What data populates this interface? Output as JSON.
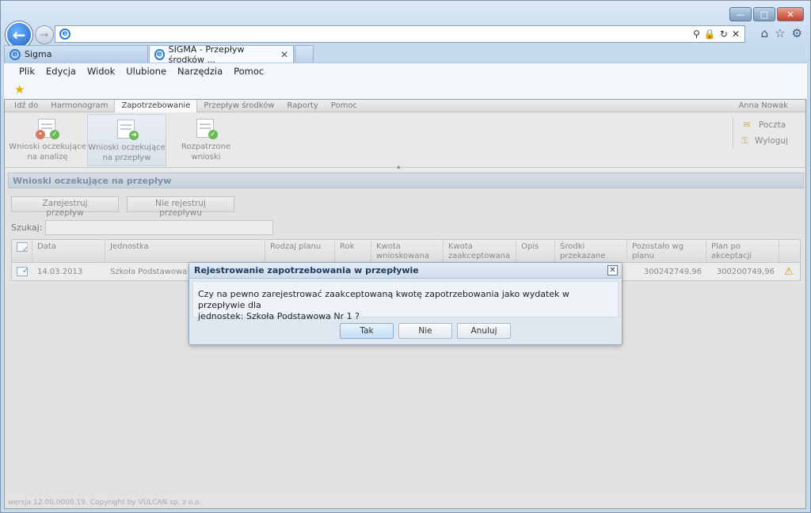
{
  "browser": {
    "tabs": [
      {
        "label": "Sigma"
      },
      {
        "label": "SIGMA - Przepływ środków ..."
      }
    ],
    "menu": [
      "Plik",
      "Edycja",
      "Widok",
      "Ulubione",
      "Narzędzia",
      "Pomoc"
    ]
  },
  "app": {
    "nav": [
      "Idź do",
      "Harmonogram",
      "Zapotrzebowanie",
      "Przepływ środków",
      "Raporty",
      "Pomoc"
    ],
    "active_nav": "Zapotrzebowanie",
    "user": "Anna Nowak",
    "ribbon": [
      {
        "label": "Wnioski oczekujące na analizę"
      },
      {
        "label": "Wnioski oczekujące na przepływ"
      },
      {
        "label": "Rozpatrzone wnioski"
      }
    ],
    "side": {
      "mail": "Poczta",
      "logout": "Wyloguj"
    },
    "panel_title": "Wnioski oczekujące na przepływ",
    "buttons": {
      "register": "Zarejestruj przepływ",
      "no_register": "Nie rejestruj przepływu"
    },
    "search_label": "Szukaj:",
    "columns": [
      "Data",
      "Jednostka",
      "Rodzaj planu",
      "Rok",
      "Kwota wnioskowana",
      "Kwota zaakceptowana",
      "Opis",
      "Środki przekazane",
      "Pozostało wg planu",
      "Plan po akceptacji"
    ],
    "row": {
      "data": "14.03.2013",
      "jednostka": "Szkoła Podstawowa Nr",
      "pozostalo": "300242749,96",
      "plan": "300200749,96"
    },
    "footer": "wersja 12.00.0000.19. Copyright by VULCAN sp. z o.o."
  },
  "dialog": {
    "title": "Rejestrowanie zapotrzebowania w przepływie",
    "message_line1": "Czy na pewno zarejestrować zaakceptowaną kwotę zapotrzebowania jako wydatek w przepływie dla",
    "message_line2": "jednostek: Szkoła Podstawowa Nr 1 ?",
    "buttons": {
      "yes": "Tak",
      "no": "Nie",
      "cancel": "Anuluj"
    }
  }
}
